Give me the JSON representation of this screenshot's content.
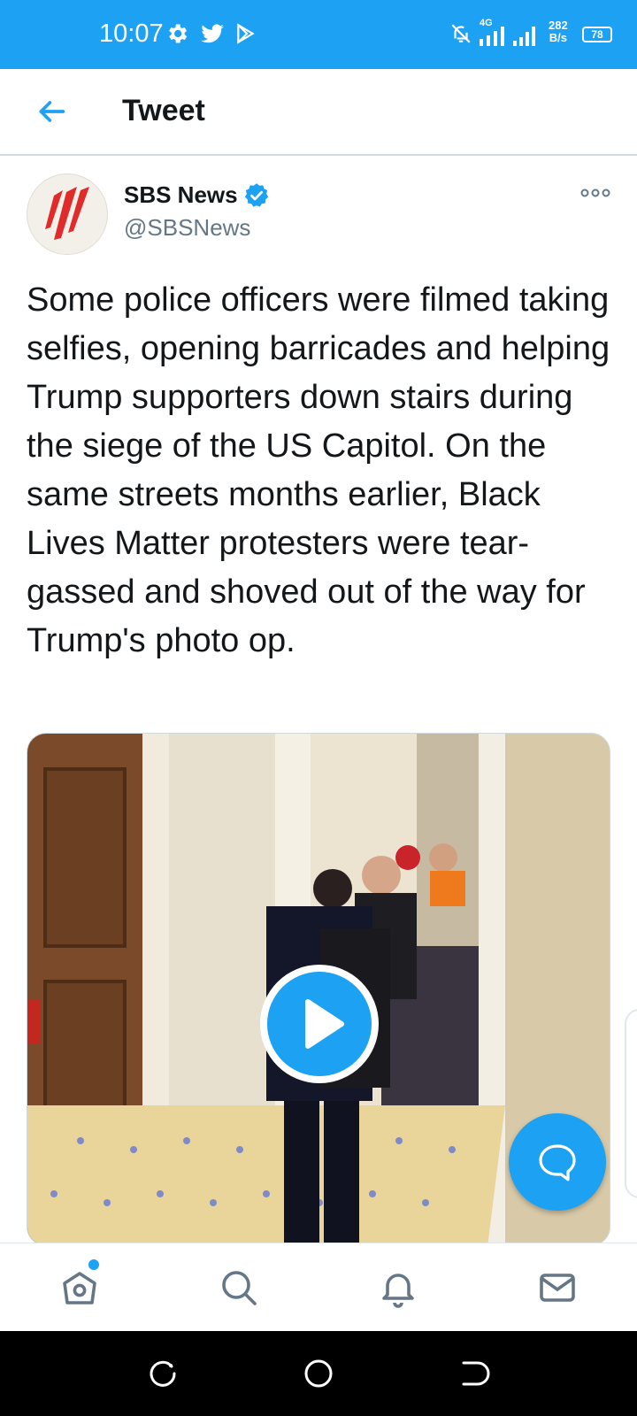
{
  "status_bar": {
    "time": "10:07",
    "left_icons": [
      "gear-icon",
      "twitter-bird-icon",
      "play-store-icon"
    ],
    "right_icons": [
      "bell-off-icon",
      "signal-4g-icon",
      "signal-icon"
    ],
    "network_type": "4G",
    "net_speed_value": "282",
    "net_speed_unit": "B/s",
    "battery": "78"
  },
  "header": {
    "title": "Tweet"
  },
  "tweet": {
    "author_name": "SBS News",
    "author_handle": "@SBSNews",
    "verified": true,
    "text": "Some police officers were filmed taking selfies, opening barricades and helping Trump supporters down stairs during the siege of the US Capitol. On the same streets months earlier, Black Lives Matter protesters were tear-gassed and shoved out of the way for Trump's photo op.",
    "media": {
      "type": "video",
      "play_icon": "play-icon"
    }
  },
  "fab": {
    "icon": "reply-bubble-icon"
  },
  "bottom_nav": {
    "items": [
      {
        "icon": "home-icon",
        "has_notification_dot": true
      },
      {
        "icon": "search-icon"
      },
      {
        "icon": "notifications-icon"
      },
      {
        "icon": "messages-icon"
      }
    ]
  },
  "system_nav": {
    "buttons": [
      "recents-icon",
      "home-circle-icon",
      "back-icon"
    ]
  },
  "colors": {
    "brand": "#1da1f2",
    "text": "#14171a",
    "secondary_text": "#657786"
  }
}
